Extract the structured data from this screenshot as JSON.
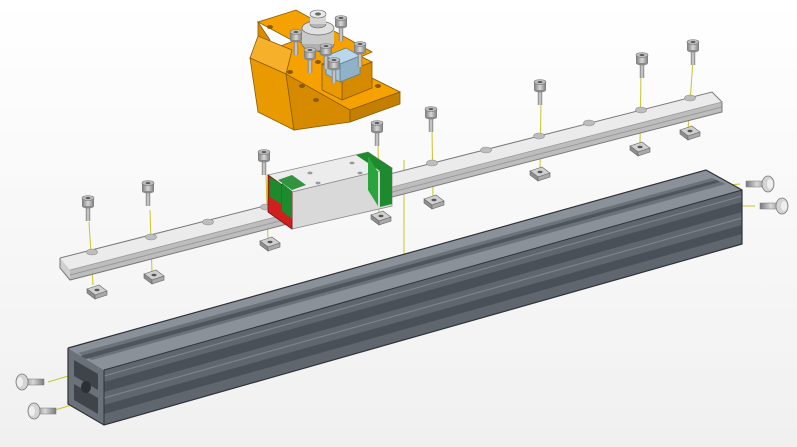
{
  "viewport": {
    "background": "#f4f4f4"
  },
  "colors": {
    "extrusion_top": "#8a9199",
    "extrusion_face": "#5f666e",
    "extrusion_dark": "#474d54",
    "rail_top": "#e9e9e9",
    "rail_side": "#bdbdbd",
    "carriage": "#e6e6e6",
    "seal_green": "#1e8a2e",
    "seal_red": "#d01f1f",
    "bracket": "#f5a100",
    "pulley": "#9fbfd6",
    "screw": "#9a9a9a",
    "tnut": "#aaaaaa",
    "guide_line": "#c9c42a"
  },
  "parts": [
    {
      "name": "aluminum-extrusion",
      "count": 1
    },
    {
      "name": "linear-rail",
      "count": 1
    },
    {
      "name": "carriage-block",
      "count": 1
    },
    {
      "name": "belt-bracket",
      "count": 1
    },
    {
      "name": "rail-screw",
      "count": 8
    },
    {
      "name": "t-nut",
      "count": 8
    },
    {
      "name": "end-cap-screw",
      "count": 4
    }
  ]
}
